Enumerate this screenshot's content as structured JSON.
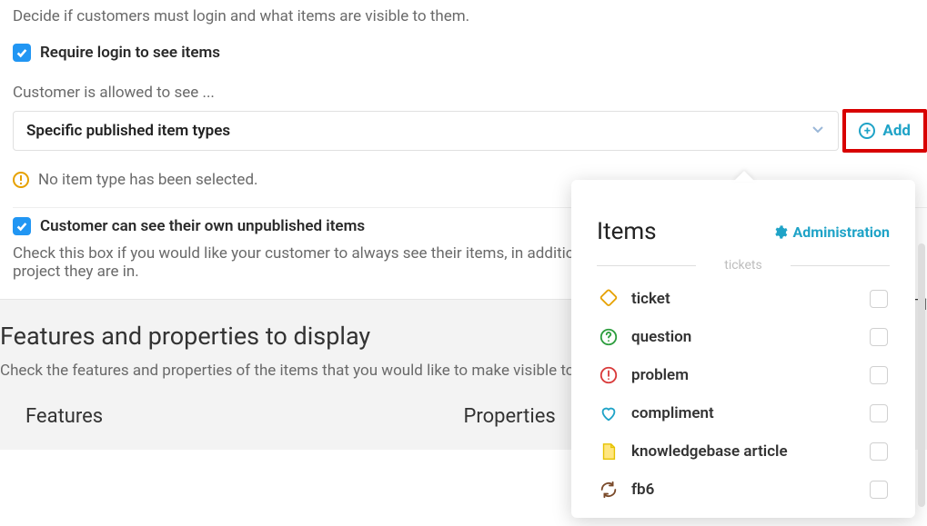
{
  "intro": "Decide if customers must login and what items are visible to them.",
  "require_login": {
    "label": "Require login to see items",
    "checked": true
  },
  "allowed_label": "Customer is allowed to see ...",
  "select_value": "Specific published item types",
  "add_label": "Add",
  "warning": "No item type has been selected.",
  "own_items": {
    "label": "Customer can see their own unpublished items",
    "checked": true,
    "help": "Check this box if you would like your customer to always see their items, in addition to the items above and regardless of which project they are in."
  },
  "features_section": {
    "title": "Features and properties to display",
    "desc": "Check the features and properties of the items that you would like to make visible to your customers.",
    "col1": "Features",
    "col2": "Properties"
  },
  "truncated_right": ". Tl",
  "popover": {
    "title": "Items",
    "admin_label": "Administration",
    "group_label": "tickets",
    "items": [
      {
        "icon": "ticket-icon",
        "label": "ticket",
        "color": "#e6a100"
      },
      {
        "icon": "question-icon",
        "label": "question",
        "color": "#2e9e3f"
      },
      {
        "icon": "problem-icon",
        "label": "problem",
        "color": "#d93b3b"
      },
      {
        "icon": "compliment-icon",
        "label": "compliment",
        "color": "#1fa3c7"
      },
      {
        "icon": "kb-icon",
        "label": "knowledgebase article",
        "color": "#e6c200"
      },
      {
        "icon": "sync-icon",
        "label": "fb6",
        "color": "#7a4a2a"
      }
    ]
  }
}
